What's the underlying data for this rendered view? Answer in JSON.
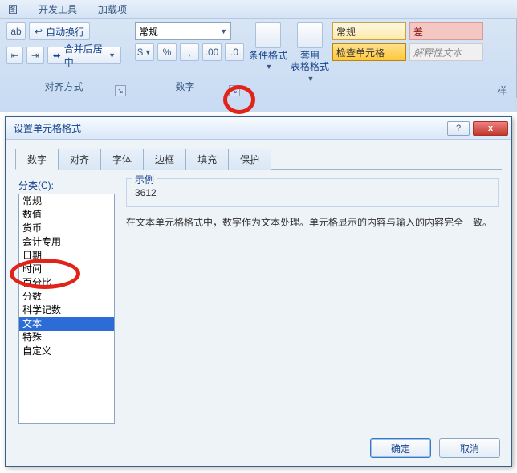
{
  "ribbon": {
    "tabs": [
      "图",
      "开发工具",
      "加载项"
    ],
    "align_group": {
      "wrap_text": "自动换行",
      "merge_center": "合并后居中",
      "label": "对齐方式"
    },
    "number_group": {
      "format_combo": "常规",
      "label": "数字"
    },
    "styles_group": {
      "cond_fmt": "条件格式",
      "table_fmt": "套用\n表格格式",
      "style_normal": "常规",
      "style_bad": "差",
      "style_check": "检查单元格",
      "style_explain": "解释性文本",
      "label_cut": "样"
    }
  },
  "dialog": {
    "title": "设置单元格格式",
    "tabs": [
      "数字",
      "对齐",
      "字体",
      "边框",
      "填充",
      "保护"
    ],
    "category_label": "分类(C):",
    "categories": [
      "常规",
      "数值",
      "货币",
      "会计专用",
      "日期",
      "时间",
      "百分比",
      "分数",
      "科学记数",
      "文本",
      "特殊",
      "自定义"
    ],
    "selected_index": 9,
    "sample_label": "示例",
    "sample_value": "3612",
    "description": "在文本单元格格式中，数字作为文本处理。单元格显示的内容与输入的内容完全一致。",
    "ok": "确定",
    "cancel": "取消",
    "help": "?",
    "close": "x"
  }
}
